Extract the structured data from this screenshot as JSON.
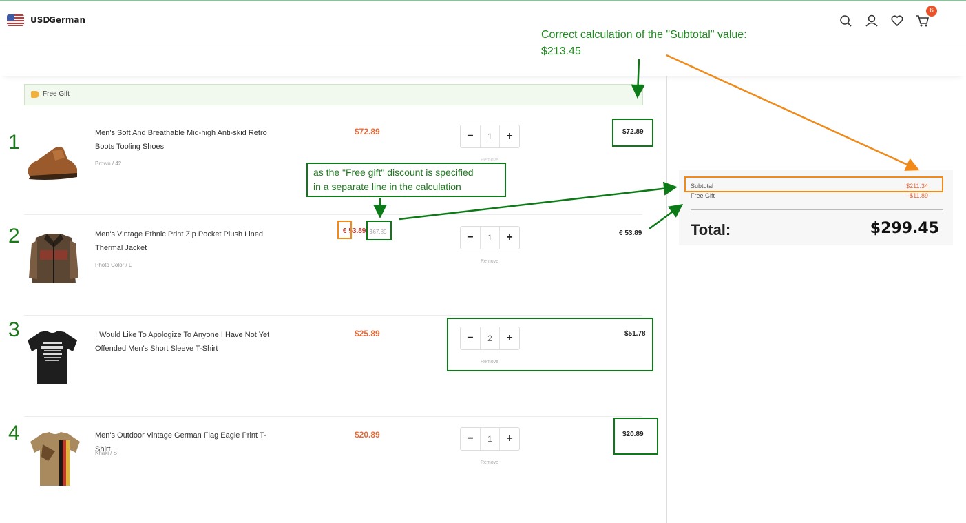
{
  "header": {
    "currency": "USD",
    "language": "German",
    "cart_count": "6",
    "icons": [
      "search-icon",
      "user-icon",
      "heart-icon",
      "cart-icon"
    ]
  },
  "gift_bar": {
    "label": "Free Gift"
  },
  "items": [
    {
      "number": "1",
      "title": "Men's Soft And Breathable Mid-high Anti-skid Retro Boots Tooling Shoes",
      "variant": "Brown / 42",
      "price": "$72.89",
      "qty": "1",
      "total": "$72.89",
      "remove": "Remove"
    },
    {
      "number": "2",
      "title": "Men's Vintage Ethnic Print Zip Pocket Plush Lined Thermal Jacket",
      "variant": "Photo Color / L",
      "price": "€ 53.89",
      "original_price": "$67.89",
      "qty": "1",
      "total": "€ 53.89",
      "remove": "Remove"
    },
    {
      "number": "3",
      "title": "I Would Like To Apologize To Anyone I Have Not Yet Offended Men's Short Sleeve T-Shirt",
      "variant": "",
      "price": "$25.89",
      "qty": "2",
      "total": "$51.78",
      "remove": "Remove"
    },
    {
      "number": "4",
      "title": "Men's Outdoor Vintage German Flag Eagle Print T-Shirt",
      "variant": "Khaki / S",
      "price": "$20.89",
      "qty": "1",
      "total": "$20.89",
      "remove": "Remove"
    }
  ],
  "summary": {
    "subtotal_label": "Subtotal",
    "subtotal_value": "$211.34",
    "gift_label": "Free Gift",
    "gift_value": "-$11.89",
    "total_label": "Total:",
    "total_value": "$299.45"
  },
  "annotations": {
    "top_note_line1": "Correct calculation of the \"Subtotal\" value:",
    "top_note_line2": "$213.45",
    "mid_note_line1": "as the \"Free gift\" discount is specified",
    "mid_note_line2": "in a separate line in the calculation",
    "green_color": "#0c7a16",
    "orange_color": "#f28a1a"
  }
}
